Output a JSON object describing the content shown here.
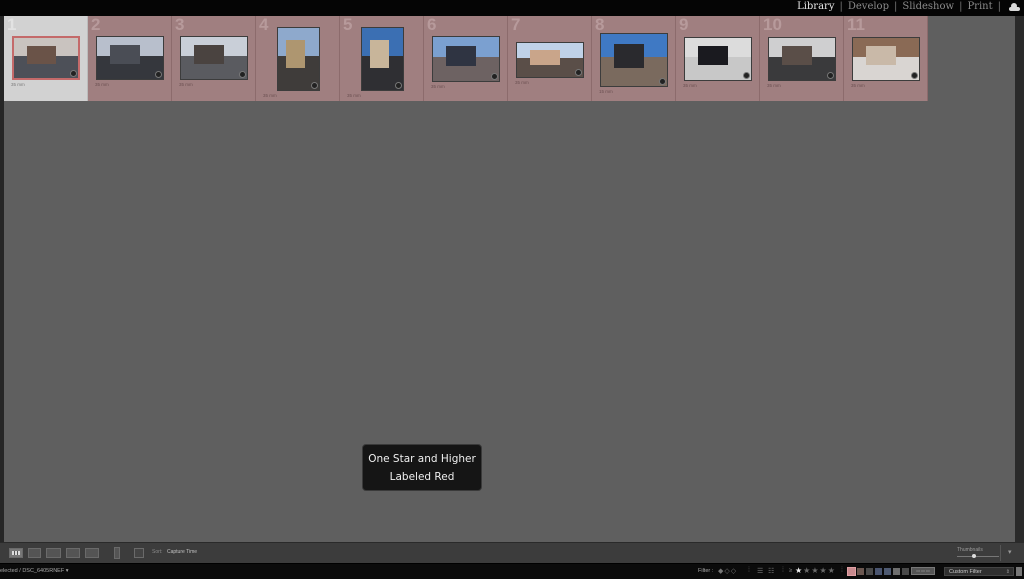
{
  "topbar": {
    "modules": [
      {
        "label": "Library",
        "active": true
      },
      {
        "label": "Develop",
        "active": false
      },
      {
        "label": "Slideshow",
        "active": false
      },
      {
        "label": "Print",
        "active": false
      }
    ],
    "separator": "|",
    "cloud_icon": "cloud-icon"
  },
  "grid": {
    "cells": [
      {
        "index": "1",
        "focal": "35 mm",
        "selected": true
      },
      {
        "index": "2",
        "focal": "35 mm",
        "selected": false
      },
      {
        "index": "3",
        "focal": "35 mm",
        "selected": false
      },
      {
        "index": "4",
        "focal": "35 mm",
        "selected": false
      },
      {
        "index": "5",
        "focal": "35 mm",
        "selected": false
      },
      {
        "index": "6",
        "focal": "35 mm",
        "selected": false
      },
      {
        "index": "7",
        "focal": "35 mm",
        "selected": false
      },
      {
        "index": "8",
        "focal": "15 mm",
        "selected": false
      },
      {
        "index": "9",
        "focal": "35 mm",
        "selected": false
      },
      {
        "index": "10",
        "focal": "35 mm",
        "selected": false
      },
      {
        "index": "11",
        "focal": "35 mm",
        "selected": false
      }
    ],
    "label_color": "#a07f80"
  },
  "toast": {
    "line1": "One Star and Higher",
    "line2": "Labeled Red"
  },
  "toolbar": {
    "sort_label": "Sort:",
    "sort_value": "Capture Time",
    "thumbnails_label": "Thumbnails",
    "thumbnail_size": 0.4
  },
  "filmstrip": {
    "path": "elected / DSC_6405RNEF ▾",
    "filter_label": "Filter :",
    "flags": "◆◇◇",
    "rating_operator": "≥",
    "rating_min": 1,
    "rating_max": 5,
    "color_labels": [
      {
        "name": "red",
        "hex": "#c98a8e",
        "active": true
      },
      {
        "name": "yellow",
        "hex": "#6b5750",
        "active": false
      },
      {
        "name": "green",
        "hex": "#4a4a4a",
        "active": false
      },
      {
        "name": "blue",
        "hex": "#4a5570",
        "active": false
      },
      {
        "name": "purple",
        "hex": "#4e5a72",
        "active": false
      },
      {
        "name": "custom",
        "hex": "#6e6e6e",
        "active": false
      },
      {
        "name": "none",
        "hex": "#4a4a4a",
        "active": false
      }
    ],
    "kind_label": "▭ ▭ ▭",
    "custom_filter": "Custom Filter"
  }
}
